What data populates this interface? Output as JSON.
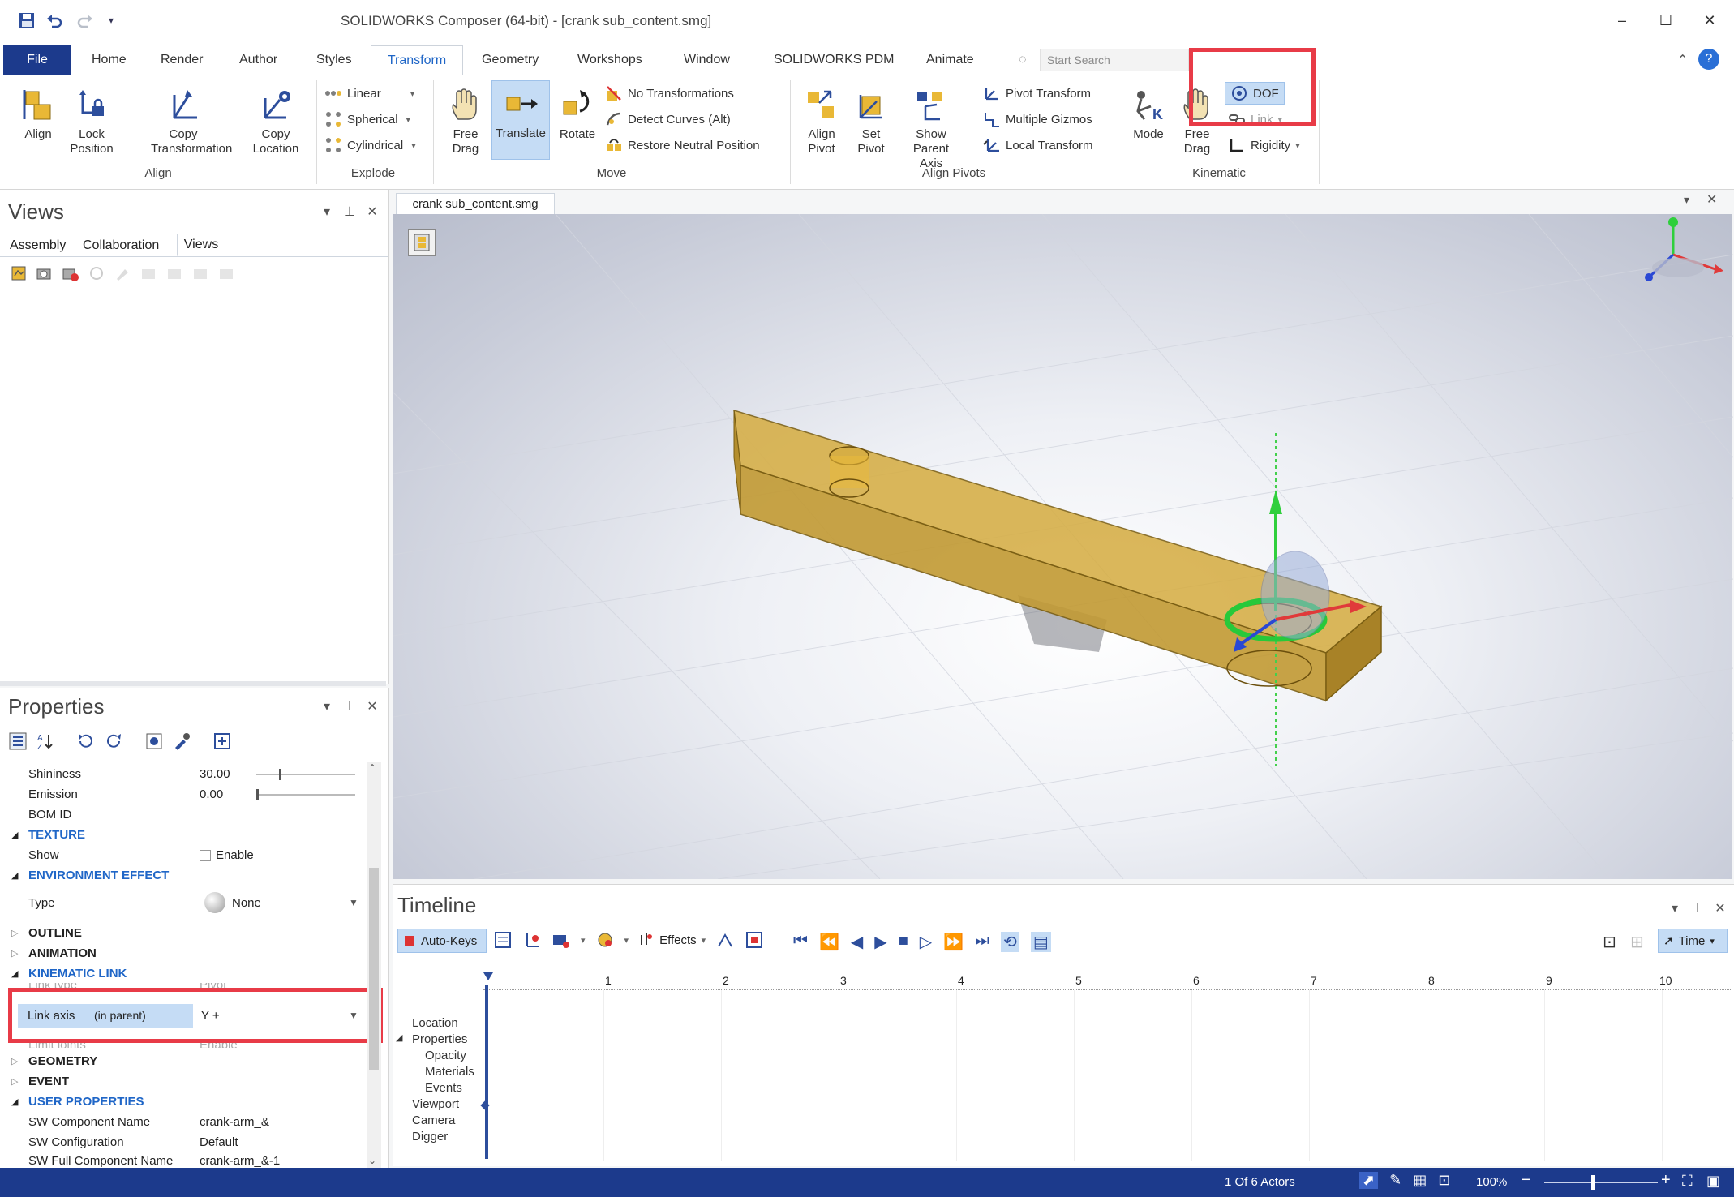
{
  "window": {
    "title": "SOLIDWORKS Composer (64-bit) - [crank sub_content.smg]",
    "quick_access": [
      "save-icon",
      "undo-icon",
      "redo-icon",
      "dropdown-icon"
    ]
  },
  "tabs": {
    "file": "File",
    "items": [
      "Home",
      "Render",
      "Author",
      "Styles",
      "Transform",
      "Geometry",
      "Workshops",
      "Window",
      "SOLIDWORKS PDM",
      "Animate"
    ],
    "active": "Transform",
    "search_placeholder": "Start Search"
  },
  "ribbon": {
    "align": {
      "group": "Align",
      "align": "Align",
      "lock_position": "Lock Position",
      "copy_transformation": "Copy Transformation",
      "copy_location": "Copy Location"
    },
    "explode": {
      "group": "Explode",
      "linear": "Linear",
      "spherical": "Spherical",
      "cylindrical": "Cylindrical"
    },
    "move": {
      "group": "Move",
      "free_drag": "Free Drag",
      "translate": "Translate",
      "rotate": "Rotate",
      "no_transformations": "No Transformations",
      "detect_curves": "Detect Curves (Alt)",
      "restore_neutral": "Restore Neutral Position"
    },
    "align_pivots": {
      "group": "Align Pivots",
      "align_pivot": "Align Pivot",
      "set_pivot": "Set Pivot",
      "show_parent_axis": "Show Parent Axis",
      "pivot_transform": "Pivot Transform",
      "multiple_gizmos": "Multiple Gizmos",
      "local_transform": "Local Transform"
    },
    "kinematic": {
      "group": "Kinematic",
      "mode": "Mode",
      "free_drag": "Free Drag",
      "dof": "DOF",
      "link": "Link",
      "rigidity": "Rigidity"
    }
  },
  "views_panel": {
    "title": "Views",
    "subtabs": [
      "Assembly",
      "Collaboration",
      "Views"
    ],
    "active_subtab": "Views"
  },
  "document_tab": "crank sub_content.smg",
  "properties_panel": {
    "title": "Properties",
    "rows": {
      "shininess": {
        "label": "Shininess",
        "value": "30.00"
      },
      "emission": {
        "label": "Emission",
        "value": "0.00"
      },
      "bom_id": {
        "label": "BOM ID",
        "value": ""
      },
      "texture": "TEXTURE",
      "show": {
        "label": "Show",
        "value": "Enable"
      },
      "environment_effect": "ENVIRONMENT EFFECT",
      "type": {
        "label": "Type",
        "value": "None"
      },
      "outline": "OUTLINE",
      "animation": "ANIMATION",
      "kinematic_link": "KINEMATIC LINK",
      "link_type": {
        "label": "Link type",
        "value": "Pivot"
      },
      "link_axis": {
        "label": "Link axis",
        "sub": "(in parent)",
        "value": "Y +"
      },
      "limit_joints": {
        "label": "Limit joints",
        "value": "Enable"
      },
      "geometry": "GEOMETRY",
      "event": "EVENT",
      "user_properties": "USER PROPERTIES",
      "sw_component_name": {
        "label": "SW Component Name",
        "value": "crank-arm_&"
      },
      "sw_configuration": {
        "label": "SW Configuration",
        "value": "Default"
      },
      "sw_full_component_name": {
        "label": "SW Full Component Name",
        "value": "crank-arm_&-1"
      }
    }
  },
  "timeline": {
    "title": "Timeline",
    "auto_keys": "Auto-Keys",
    "effects": "Effects",
    "time_mode": "Time",
    "ruler": [
      "1",
      "2",
      "3",
      "4",
      "5",
      "6",
      "7",
      "8",
      "9",
      "10"
    ],
    "tracks": [
      "Location",
      "Properties",
      "Opacity",
      "Materials",
      "Events",
      "Viewport",
      "Camera",
      "Digger"
    ]
  },
  "status": {
    "actors": "1 Of 6 Actors",
    "zoom": "100%"
  },
  "colors": {
    "accent": "#1f66c7",
    "file_tab": "#1c3a8c",
    "highlight": "#e83b47",
    "part": "#d9b24a"
  }
}
